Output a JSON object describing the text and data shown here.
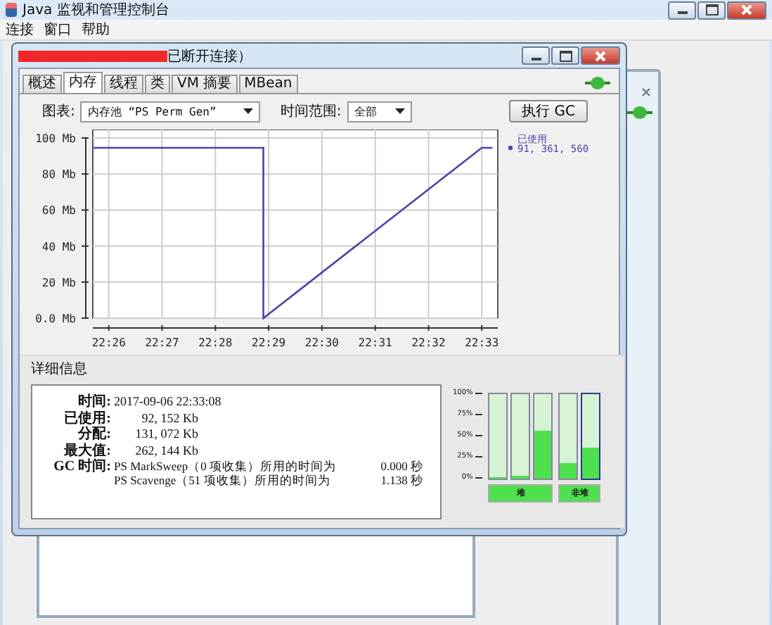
{
  "app": {
    "title": "Java 监视和管理控制台",
    "menu": [
      "连接",
      "窗口",
      "帮助"
    ]
  },
  "window": {
    "title": "已断开连接）",
    "tabs": [
      {
        "label": "概述",
        "selected": false
      },
      {
        "label": "内存",
        "selected": true
      },
      {
        "label": "线程",
        "selected": false
      },
      {
        "label": "类",
        "selected": false
      },
      {
        "label": "VM 摘要",
        "selected": false
      },
      {
        "label": "MBean",
        "selected": false
      }
    ]
  },
  "toolbar": {
    "chart_label": "图表:",
    "chart_select": "内存池 “PS Perm Gen”",
    "range_label": "时间范围:",
    "range_select": "全部",
    "gc_button": "执行 GC"
  },
  "chart": {
    "legend_value": "91, 361, 560",
    "chart_data": {
      "type": "line",
      "x": [
        1345.7,
        1348.9,
        1348.9,
        1353.0,
        1353.2
      ],
      "series": [
        {
          "name": "已使用",
          "color": "#4a44a8",
          "values": [
            94.5,
            94.5,
            0,
            94.5,
            94.5
          ]
        }
      ],
      "xlim": [
        1345.7,
        1353.3
      ],
      "ylim": [
        0,
        100
      ],
      "grid": true,
      "xticks": [
        {
          "value": 1346,
          "label": "22:26"
        },
        {
          "value": 1347,
          "label": "22:27"
        },
        {
          "value": 1348,
          "label": "22:28"
        },
        {
          "value": 1349,
          "label": "22:29"
        },
        {
          "value": 1350,
          "label": "22:30"
        },
        {
          "value": 1351,
          "label": "22:31"
        },
        {
          "value": 1352,
          "label": "22:32"
        },
        {
          "value": 1353,
          "label": "22:33"
        }
      ],
      "yticks": [
        {
          "value": 0,
          "label": "0.0 Mb"
        },
        {
          "value": 20,
          "label": "20 Mb"
        },
        {
          "value": 40,
          "label": "40 Mb"
        },
        {
          "value": 60,
          "label": "60 Mb"
        },
        {
          "value": 80,
          "label": "80 Mb"
        },
        {
          "value": 100,
          "label": "100 Mb"
        }
      ]
    }
  },
  "details": {
    "heading": "详细信息",
    "rows": [
      {
        "label": "时间:",
        "value": "2017-09-06 22:33:08"
      },
      {
        "label": "已使用:",
        "value": "92, 152 Kb"
      },
      {
        "label": "分配:",
        "value": "131, 072 Kb"
      },
      {
        "label": "最大值:",
        "value": "262, 144 Kb"
      }
    ],
    "gc": {
      "label": "GC 时间:",
      "entries": [
        {
          "text": "PS MarkSweep（0 项收集）所用的时间为",
          "time": "0.000 秒"
        },
        {
          "text": "PS Scavenge（51 项收集）所用的时间为",
          "time": "1.138 秒"
        }
      ]
    }
  },
  "meters": {
    "scale": [
      "100%",
      "75%",
      "50%",
      "25%",
      "0%"
    ],
    "groups": [
      {
        "label": "堆",
        "bars": [
          {
            "level": 0.02,
            "selected": false
          },
          {
            "level": 0.03,
            "selected": false
          },
          {
            "level": 0.56,
            "selected": false
          }
        ]
      },
      {
        "label": "非堆",
        "bars": [
          {
            "level": 0.18,
            "selected": false
          },
          {
            "level": 0.36,
            "selected": true
          }
        ]
      }
    ]
  }
}
